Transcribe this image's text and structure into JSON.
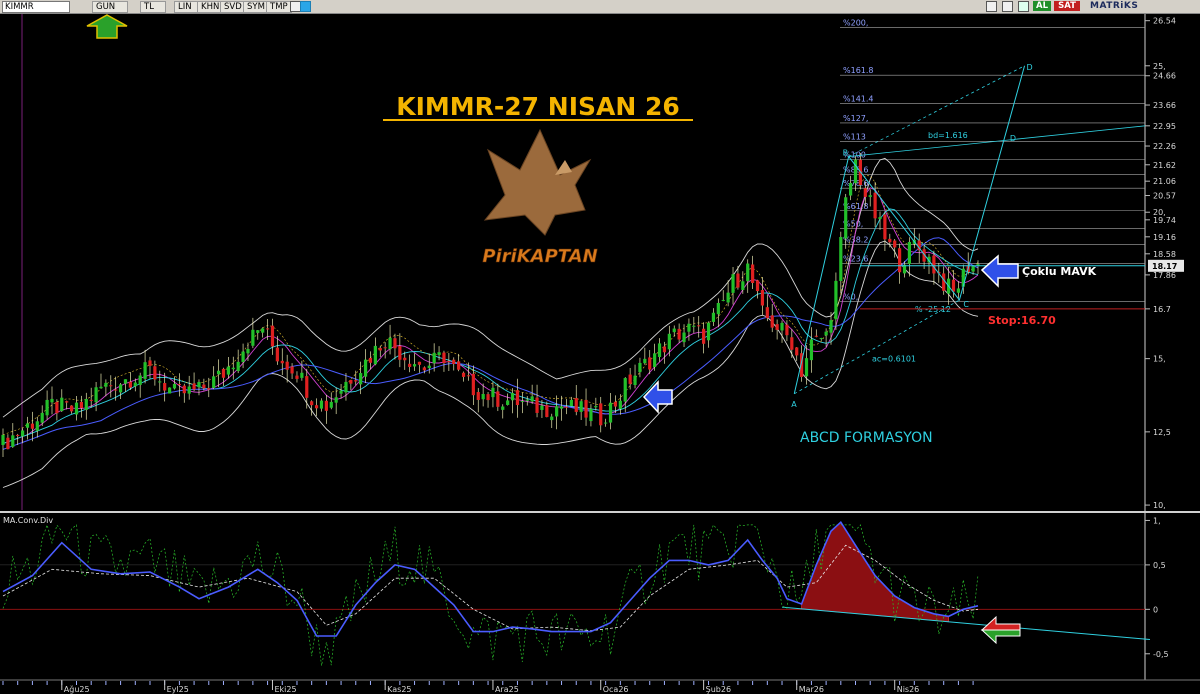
{
  "toolbar": {
    "symbol": "KIMMR",
    "period": "GUN",
    "currency": "TL",
    "scale": "LIN",
    "buttons": [
      "KHN",
      "SVD",
      "SYM",
      "TMP"
    ],
    "buy_label": "AL",
    "sell_label": "SAT",
    "brand": "MATRiKS"
  },
  "chart_title": "KIMMR-27 NISAN 26",
  "logo_text": "PiriKAPTAN",
  "annotations": {
    "pattern": "ABCD FORMASYON",
    "mavk": "Çoklu MAVK",
    "stop": "Stop:16.70",
    "point_a": "A",
    "point_b": "B",
    "point_c": "C",
    "point_d": "D",
    "point_d2": "D",
    "ratio_bd": "bd=1.616",
    "ratio_ac": "ac=0.6101",
    "ratio_c": "% -25.12"
  },
  "fib_levels": [
    {
      "label": "%200,",
      "price": 26.3
    },
    {
      "label": "%161.8",
      "price": 24.68
    },
    {
      "label": "%141.4",
      "price": 23.72
    },
    {
      "label": "%127,",
      "price": 23.05
    },
    {
      "label": "%113",
      "price": 22.42
    },
    {
      "label": "%100",
      "price": 21.8
    },
    {
      "label": "%88.6",
      "price": 21.28
    },
    {
      "label": "%78.6",
      "price": 20.82
    },
    {
      "label": "%61.8",
      "price": 20.05
    },
    {
      "label": "%50,",
      "price": 19.45
    },
    {
      "label": "%38.2",
      "price": 18.9
    },
    {
      "label": "%23.6",
      "price": 18.25
    },
    {
      "label": "%0,",
      "price": 16.95
    }
  ],
  "chart_data": {
    "type": "candlestick",
    "price_axis": {
      "ylim": [
        9.9,
        26.7
      ],
      "ticks": [
        {
          "label": "26.54",
          "value": 26.54
        },
        {
          "label": "25,",
          "value": 25.0
        },
        {
          "label": "24.66",
          "value": 24.66
        },
        {
          "label": "23.66",
          "value": 23.66
        },
        {
          "label": "22.95",
          "value": 22.95
        },
        {
          "label": "22.26",
          "value": 22.26
        },
        {
          "label": "21.62",
          "value": 21.62
        },
        {
          "label": "21.06",
          "value": 21.06
        },
        {
          "label": "20.57",
          "value": 20.57
        },
        {
          "label": "20,",
          "value": 20.0
        },
        {
          "label": "19.74",
          "value": 19.74
        },
        {
          "label": "19.16",
          "value": 19.16
        },
        {
          "label": "18.58",
          "value": 18.58
        },
        {
          "label": "17.86",
          "value": 17.86
        },
        {
          "label": "16.7",
          "value": 16.7
        },
        {
          "label": "15,",
          "value": 15.0
        },
        {
          "label": "12,5",
          "value": 12.5
        },
        {
          "label": "10,",
          "value": 10.0
        }
      ],
      "last_price": {
        "label": "18.17",
        "value": 18.17
      }
    },
    "x_axis": {
      "ticks": [
        "Ağu25",
        "Eyl25",
        "Eki25",
        "Kas25",
        "Ara25",
        "Oca26",
        "Şub26",
        "Mar26",
        "Nis26"
      ],
      "tick_index": [
        12,
        33,
        55,
        78,
        100,
        122,
        143,
        162,
        182
      ]
    },
    "price_series": [
      [
        0,
        12.1
      ],
      [
        5,
        12.7
      ],
      [
        10,
        13.4
      ],
      [
        15,
        13.2
      ],
      [
        20,
        14.0
      ],
      [
        25,
        14.3
      ],
      [
        30,
        14.6
      ],
      [
        35,
        13.8
      ],
      [
        40,
        13.9
      ],
      [
        45,
        14.5
      ],
      [
        50,
        15.6
      ],
      [
        53,
        16.1
      ],
      [
        56,
        15.1
      ],
      [
        60,
        14.6
      ],
      [
        63,
        13.7
      ],
      [
        66,
        13.4
      ],
      [
        70,
        14.2
      ],
      [
        74,
        14.9
      ],
      [
        78,
        15.7
      ],
      [
        82,
        15.1
      ],
      [
        86,
        14.7
      ],
      [
        90,
        15.1
      ],
      [
        94,
        14.2
      ],
      [
        98,
        13.8
      ],
      [
        102,
        13.6
      ],
      [
        106,
        13.5
      ],
      [
        110,
        13.3
      ],
      [
        114,
        13.4
      ],
      [
        118,
        13.2
      ],
      [
        122,
        13.0
      ],
      [
        125,
        13.5
      ],
      [
        128,
        14.3
      ],
      [
        131,
        14.8
      ],
      [
        134,
        15.3
      ],
      [
        137,
        15.8
      ],
      [
        140,
        16.0
      ],
      [
        143,
        15.8
      ],
      [
        146,
        16.6
      ],
      [
        149,
        17.6
      ],
      [
        152,
        18.1
      ],
      [
        155,
        16.5
      ],
      [
        158,
        16.1
      ],
      [
        161,
        15.6
      ],
      [
        163,
        14.6
      ],
      [
        165,
        15.5
      ],
      [
        168,
        15.8
      ],
      [
        170,
        17.5
      ],
      [
        172,
        20.3
      ],
      [
        174,
        21.7
      ],
      [
        176,
        20.6
      ],
      [
        178,
        19.9
      ],
      [
        180,
        19.1
      ],
      [
        183,
        18.3
      ],
      [
        186,
        18.9
      ],
      [
        189,
        18.4
      ],
      [
        192,
        17.6
      ],
      [
        194,
        17.2
      ],
      [
        197,
        18.2
      ],
      [
        199,
        18.17
      ]
    ],
    "indicator": {
      "name": "MA.Conv.Div",
      "ylim": [
        -0.75,
        1.05
      ],
      "ticks": [
        {
          "label": "1,",
          "value": 1.0
        },
        {
          "label": "0,5",
          "value": 0.5
        },
        {
          "label": "0",
          "value": 0.0
        },
        {
          "label": "-0,5",
          "value": -0.5
        }
      ],
      "macd": [
        [
          0,
          0.2
        ],
        [
          6,
          0.38
        ],
        [
          12,
          0.75
        ],
        [
          18,
          0.45
        ],
        [
          24,
          0.4
        ],
        [
          30,
          0.42
        ],
        [
          36,
          0.25
        ],
        [
          40,
          0.12
        ],
        [
          46,
          0.25
        ],
        [
          52,
          0.45
        ],
        [
          56,
          0.3
        ],
        [
          60,
          0.1
        ],
        [
          64,
          -0.3
        ],
        [
          68,
          -0.3
        ],
        [
          72,
          0.05
        ],
        [
          76,
          0.3
        ],
        [
          80,
          0.5
        ],
        [
          84,
          0.45
        ],
        [
          88,
          0.25
        ],
        [
          92,
          0.05
        ],
        [
          96,
          -0.25
        ],
        [
          100,
          -0.25
        ],
        [
          104,
          -0.2
        ],
        [
          108,
          -0.22
        ],
        [
          112,
          -0.25
        ],
        [
          116,
          -0.25
        ],
        [
          120,
          -0.25
        ],
        [
          124,
          -0.15
        ],
        [
          128,
          0.1
        ],
        [
          132,
          0.35
        ],
        [
          136,
          0.55
        ],
        [
          140,
          0.55
        ],
        [
          144,
          0.5
        ],
        [
          148,
          0.55
        ],
        [
          152,
          0.78
        ],
        [
          155,
          0.55
        ],
        [
          158,
          0.35
        ],
        [
          160,
          0.12
        ],
        [
          163,
          0.06
        ],
        [
          166,
          0.5
        ],
        [
          169,
          0.88
        ],
        [
          171,
          0.98
        ],
        [
          174,
          0.72
        ],
        [
          178,
          0.38
        ],
        [
          182,
          0.15
        ],
        [
          186,
          0.02
        ],
        [
          190,
          -0.05
        ],
        [
          193,
          -0.08
        ],
        [
          196,
          0.0
        ],
        [
          199,
          0.04
        ]
      ],
      "signal": [
        [
          0,
          0.15
        ],
        [
          10,
          0.45
        ],
        [
          20,
          0.4
        ],
        [
          30,
          0.38
        ],
        [
          40,
          0.25
        ],
        [
          50,
          0.35
        ],
        [
          60,
          0.2
        ],
        [
          66,
          -0.18
        ],
        [
          72,
          -0.05
        ],
        [
          80,
          0.35
        ],
        [
          88,
          0.35
        ],
        [
          96,
          0.0
        ],
        [
          104,
          -0.22
        ],
        [
          112,
          -0.2
        ],
        [
          120,
          -0.24
        ],
        [
          126,
          -0.2
        ],
        [
          132,
          0.15
        ],
        [
          140,
          0.45
        ],
        [
          148,
          0.5
        ],
        [
          154,
          0.55
        ],
        [
          160,
          0.25
        ],
        [
          166,
          0.3
        ],
        [
          172,
          0.72
        ],
        [
          178,
          0.55
        ],
        [
          184,
          0.3
        ],
        [
          190,
          0.1
        ],
        [
          196,
          -0.02
        ],
        [
          199,
          0.0
        ]
      ]
    }
  },
  "colors": {
    "background": "#000000",
    "candle_up": "#22c02a",
    "candle_down": "#e02020",
    "title": "#f4b400",
    "cyan": "#2fd0e0",
    "macd_line": "#4a5cff",
    "signal_line": "#e8e8e8",
    "histogram_fill": "#8b0f12"
  }
}
